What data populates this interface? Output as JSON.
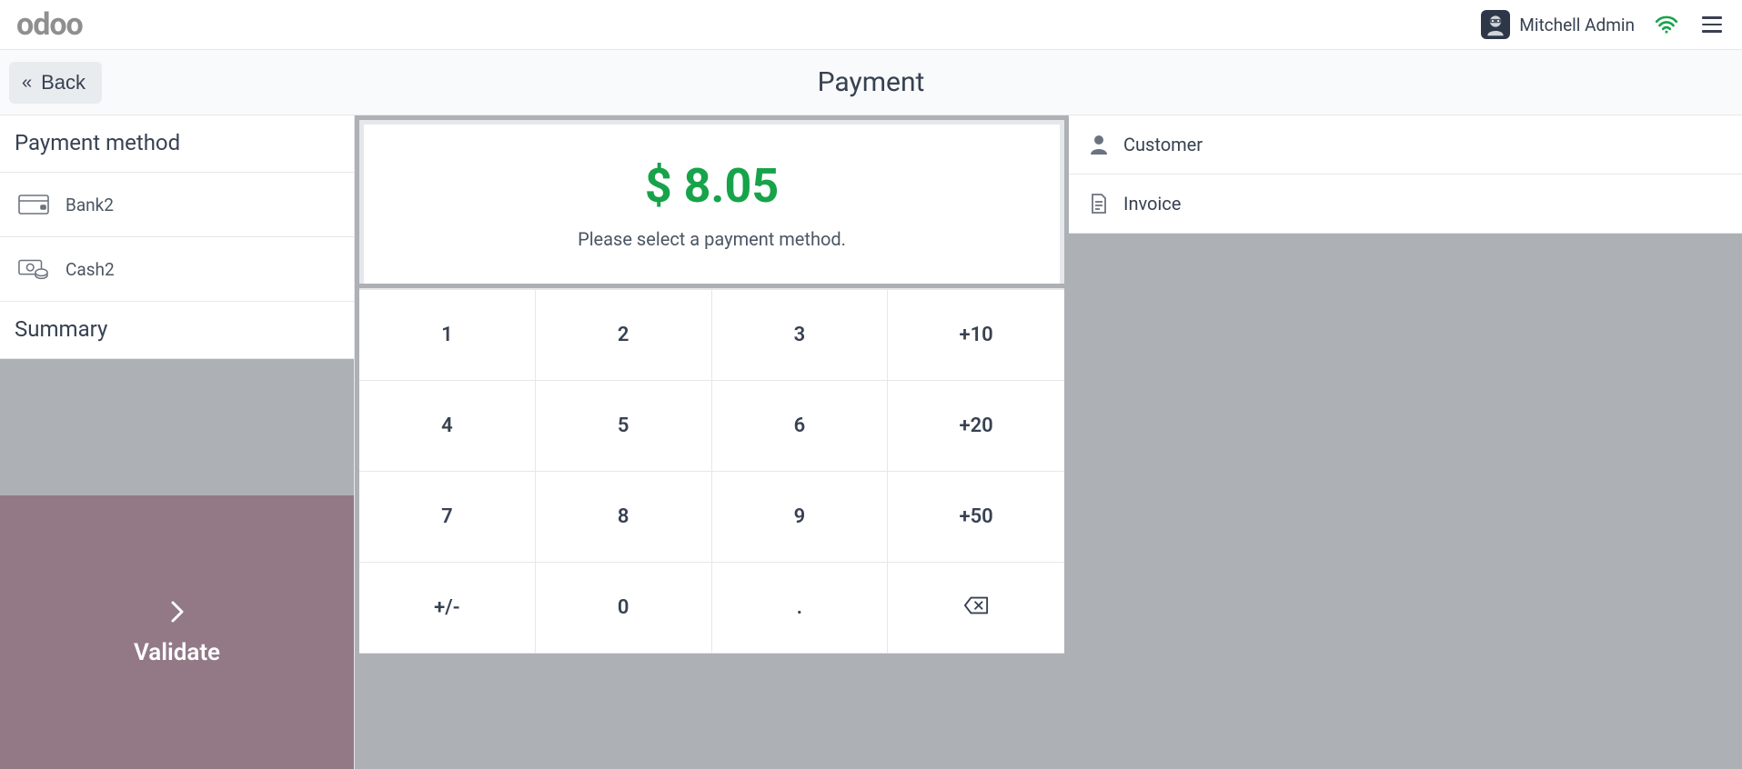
{
  "header": {
    "logo": "odoo",
    "user_name": "Mitchell Admin"
  },
  "titlebar": {
    "back_label": "Back",
    "page_title": "Payment"
  },
  "left": {
    "payment_method_header": "Payment method",
    "methods": [
      {
        "name": "Bank2"
      },
      {
        "name": "Cash2"
      }
    ],
    "summary_header": "Summary",
    "validate_label": "Validate"
  },
  "center": {
    "amount": "$ 8.05",
    "subtext": "Please select a payment method.",
    "keys": {
      "k1": "1",
      "k2": "2",
      "k3": "3",
      "k_plus10": "+10",
      "k4": "4",
      "k5": "5",
      "k6": "6",
      "k_plus20": "+20",
      "k7": "7",
      "k8": "8",
      "k9": "9",
      "k_plus50": "+50",
      "k_sign": "+/-",
      "k0": "0",
      "k_dot": "."
    }
  },
  "right": {
    "customer_label": "Customer",
    "invoice_label": "Invoice"
  }
}
